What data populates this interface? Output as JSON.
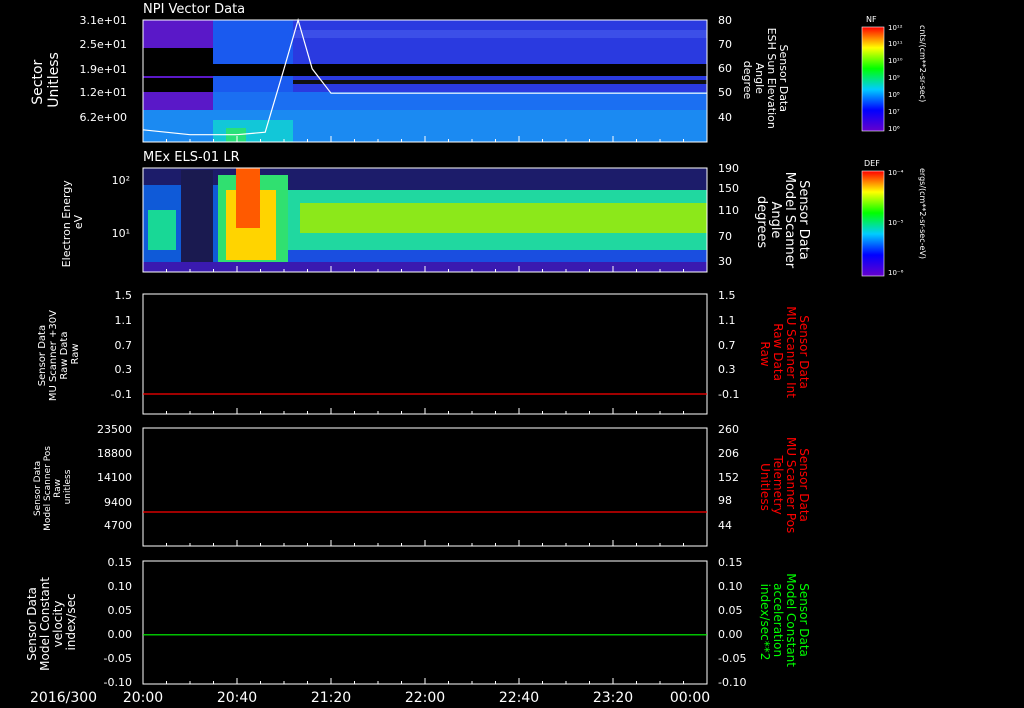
{
  "date_label": "2016/300",
  "time_ticks": [
    "20:00",
    "20:40",
    "21:20",
    "22:00",
    "22:40",
    "23:20",
    "00:00"
  ],
  "panels": [
    {
      "title": "NPI Vector Data",
      "left_label": [
        "Sector",
        "Unitless"
      ],
      "right_label": [
        "Sensor Data",
        "ESH Sun Elevation",
        "Angle",
        "degree"
      ],
      "left_ticks": [
        "3.1e+01",
        "2.5e+01",
        "1.9e+01",
        "1.2e+01",
        "6.2e+00"
      ],
      "right_ticks": [
        "80",
        "70",
        "60",
        "50",
        "40"
      ]
    },
    {
      "title": "MEx ELS-01 LR",
      "left_label": [
        "Electron Energy",
        "eV"
      ],
      "right_label": [
        "Sensor Data",
        "Model Scanner",
        "Angle",
        "degrees"
      ],
      "left_ticks": [
        "10²",
        "10¹"
      ],
      "right_ticks": [
        "190",
        "150",
        "110",
        "70",
        "30"
      ]
    },
    {
      "title": "",
      "left_label": [
        "Sensor Data",
        "MU Scanner +30V",
        "Raw Data",
        "Raw"
      ],
      "right_label": [
        "Sensor Data",
        "MU Scanner Int",
        "Raw Data",
        "Raw"
      ],
      "left_ticks": [
        "1.5",
        "1.1",
        "0.7",
        "0.3",
        "-0.1"
      ],
      "right_ticks": [
        "1.5",
        "1.1",
        "0.7",
        "0.3",
        "-0.1"
      ]
    },
    {
      "title": "",
      "left_label": [
        "Sensor Data",
        "Model Scanner Pos",
        "Raw",
        "unitless"
      ],
      "right_label": [
        "Sensor Data",
        "MU Scanner Pos",
        "Telemetry",
        "Unitless"
      ],
      "left_ticks": [
        "23500",
        "18800",
        "14100",
        "9400",
        "4700"
      ],
      "right_ticks": [
        "260",
        "206",
        "152",
        "98",
        "44"
      ]
    },
    {
      "title": "",
      "left_label": [
        "Sensor Data",
        "Model Constant",
        "velocity",
        "index/sec"
      ],
      "right_label": [
        "Sensor Data",
        "Model Constant",
        "acceleration",
        "index/sec**2"
      ],
      "left_ticks": [
        "0.15",
        "0.10",
        "0.05",
        "0.00",
        "-0.05",
        "-0.10"
      ],
      "right_ticks": [
        "0.15",
        "0.10",
        "0.05",
        "0.00",
        "-0.05",
        "-0.10"
      ]
    }
  ],
  "colorbars": [
    {
      "tag": "NF",
      "unit": "cnts/(cm**2-sr-sec)",
      "ticks": [
        "10¹²",
        "10¹¹",
        "10¹⁰",
        "10⁹",
        "10⁸",
        "10⁷",
        "10⁶"
      ]
    },
    {
      "tag": "DEF",
      "unit": "ergs/(cm**2-sr-sec-eV)",
      "ticks": [
        "10⁻⁴",
        "10⁻⁵",
        "10⁻⁶"
      ]
    }
  ],
  "colors": {
    "white": "#ffffff",
    "red": "#ff0000",
    "green": "#00ff00"
  },
  "chart_data": [
    {
      "type": "heatmap",
      "title": "NPI Vector Data",
      "x_range": [
        "20:00",
        "00:00"
      ],
      "ylim": [
        0,
        31
      ],
      "overlay": {
        "name": "ESH Sun Elevation Angle",
        "color": "#ffffff",
        "axis": "right",
        "ylim": [
          30,
          80
        ],
        "x": [
          "20:00",
          "20:20",
          "20:40",
          "20:52",
          "21:00",
          "21:06",
          "21:12",
          "21:20",
          "22:00",
          "23:00",
          "00:00"
        ],
        "y": [
          35,
          33,
          33,
          34,
          60,
          80,
          60,
          50,
          50,
          50,
          50
        ]
      }
    },
    {
      "type": "heatmap",
      "title": "MEx ELS-01 LR",
      "yscale": "log",
      "ylim": [
        2,
        200
      ]
    },
    {
      "type": "line",
      "x_range": [
        "20:00",
        "00:00"
      ],
      "ylim": [
        -0.3,
        1.5
      ],
      "series": [
        {
          "color": "#ff0000",
          "axis": "right",
          "values": [
            0,
            0
          ]
        }
      ]
    },
    {
      "type": "line",
      "x_range": [
        "20:00",
        "00:00"
      ],
      "ylim": [
        0,
        23500
      ],
      "series": [
        {
          "color": "#ff0000",
          "axis": "right",
          "values": [
            87,
            87
          ]
        }
      ]
    },
    {
      "type": "line",
      "x_range": [
        "20:00",
        "00:00"
      ],
      "ylim": [
        -0.1,
        0.15
      ],
      "series": [
        {
          "color": "#00ff00",
          "axis": "right",
          "values": [
            0,
            0
          ]
        }
      ]
    }
  ]
}
